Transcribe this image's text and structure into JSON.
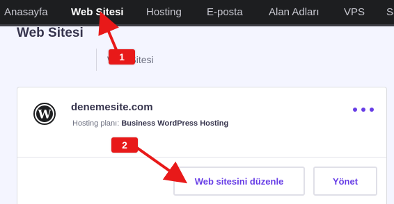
{
  "topnav": {
    "items": [
      {
        "label": "Anasayfa",
        "active": false
      },
      {
        "label": "Web Sitesi",
        "active": true
      },
      {
        "label": "Hosting",
        "active": false
      },
      {
        "label": "E-posta",
        "active": false
      },
      {
        "label": "Alan Adları",
        "active": false
      },
      {
        "label": "VPS",
        "active": false
      },
      {
        "label": "SS",
        "active": false
      }
    ]
  },
  "header": {
    "title": "Web Sitesi",
    "breadcrumb": "Web Sitesi"
  },
  "site": {
    "name": "denemesite.com",
    "plan_label": "Hosting planı:",
    "plan_value": "Business WordPress Hosting",
    "logo_icon": "wordpress-icon",
    "more_icon": "more-options-icon"
  },
  "actions": {
    "edit_label": "Web sitesini düzenle",
    "manage_label": "Yönet"
  },
  "annotations": {
    "step1": "1",
    "step2": "2"
  },
  "colors": {
    "accent": "#673de6",
    "nav_bg": "#1d1e20",
    "annotation": "#e81919"
  }
}
